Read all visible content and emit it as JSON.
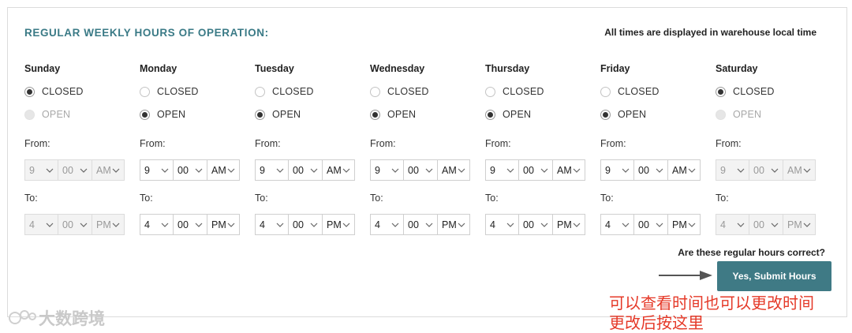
{
  "header": {
    "title": "REGULAR WEEKLY HOURS OF OPERATION:",
    "timezone_note": "All times are displayed in warehouse local time"
  },
  "labels": {
    "closed": "CLOSED",
    "open": "OPEN",
    "from": "From:",
    "to": "To:"
  },
  "days": [
    {
      "name": "Sunday",
      "status": "closed",
      "from": {
        "hour": "9",
        "minute": "00",
        "period": "AM"
      },
      "to": {
        "hour": "4",
        "minute": "00",
        "period": "PM"
      }
    },
    {
      "name": "Monday",
      "status": "open",
      "from": {
        "hour": "9",
        "minute": "00",
        "period": "AM"
      },
      "to": {
        "hour": "4",
        "minute": "00",
        "period": "PM"
      }
    },
    {
      "name": "Tuesday",
      "status": "open",
      "from": {
        "hour": "9",
        "minute": "00",
        "period": "AM"
      },
      "to": {
        "hour": "4",
        "minute": "00",
        "period": "PM"
      }
    },
    {
      "name": "Wednesday",
      "status": "open",
      "from": {
        "hour": "9",
        "minute": "00",
        "period": "AM"
      },
      "to": {
        "hour": "4",
        "minute": "00",
        "period": "PM"
      }
    },
    {
      "name": "Thursday",
      "status": "open",
      "from": {
        "hour": "9",
        "minute": "00",
        "period": "AM"
      },
      "to": {
        "hour": "4",
        "minute": "00",
        "period": "PM"
      }
    },
    {
      "name": "Friday",
      "status": "open",
      "from": {
        "hour": "9",
        "minute": "00",
        "period": "AM"
      },
      "to": {
        "hour": "4",
        "minute": "00",
        "period": "PM"
      }
    },
    {
      "name": "Saturday",
      "status": "closed",
      "from": {
        "hour": "9",
        "minute": "00",
        "period": "AM"
      },
      "to": {
        "hour": "4",
        "minute": "00",
        "period": "PM"
      }
    }
  ],
  "confirm": {
    "question": "Are these regular hours correct?",
    "submit_label": "Yes, Submit Hours"
  },
  "annotation": {
    "line1": "可以查看时间也可以更改时间",
    "line2": "更改后按这里"
  },
  "watermark": {
    "text": "大数跨境"
  },
  "colors": {
    "accent": "#3f7a85",
    "annotation": "#e53928"
  }
}
